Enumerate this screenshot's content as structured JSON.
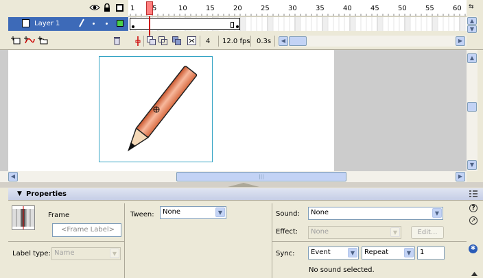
{
  "timeline": {
    "ruler_numbers": [
      "1",
      "5",
      "10",
      "15",
      "20",
      "25",
      "30",
      "35",
      "40",
      "45",
      "50",
      "55",
      "60"
    ],
    "layer_name": "Layer 1",
    "current_frame": "4",
    "frame_rate": "12.0 fps",
    "elapsed_time": "0.3s"
  },
  "properties": {
    "title": "Properties",
    "frame_label": "Frame",
    "frame_label_placeholder": "<Frame Label>",
    "tween_label": "Tween:",
    "tween_value": "None",
    "sound_label": "Sound:",
    "sound_value": "None",
    "effect_label": "Effect:",
    "effect_value": "None",
    "edit_button": "Edit...",
    "label_type_label": "Label type:",
    "label_type_value": "Name",
    "sync_label": "Sync:",
    "sync_value": "Event",
    "repeat_value": "Repeat",
    "repeat_count": "1",
    "sound_status": "No sound selected."
  },
  "colors": {
    "selected_layer": "#3d6ab8",
    "playhead": "#ff8080",
    "stage_bg": "#cccccc",
    "pencil": "#e8825c"
  }
}
